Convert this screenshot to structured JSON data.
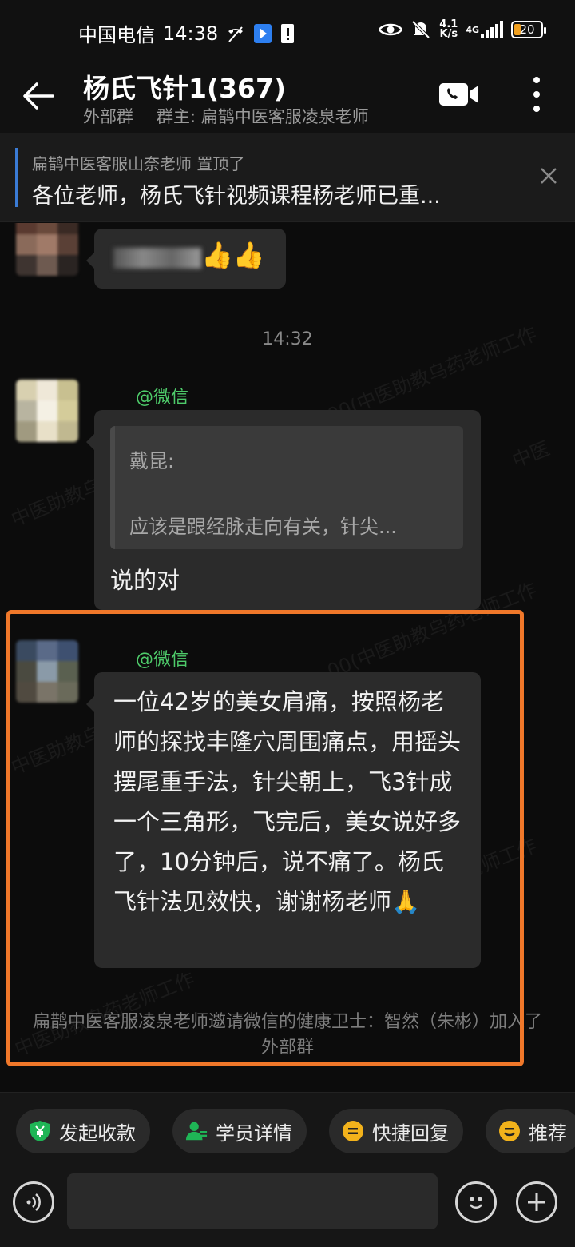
{
  "status_bar": {
    "carrier": "中国电信",
    "time": "14:38",
    "net_speed": "4.1",
    "net_unit": "K/s",
    "net_type": "4G",
    "battery": "20",
    "icons": [
      "no-call-icon",
      "app-notification-icon",
      "sim-alert-icon",
      "eye-icon",
      "mute-bell-icon",
      "signal-icon",
      "battery-icon"
    ]
  },
  "header": {
    "title": "杨氏飞针1(367)",
    "group_type": "外部群",
    "owner": "群主: 扁鹊中医客服凌泉老师"
  },
  "pinned": {
    "who": "扁鹊中医客服山奈老师 置顶了",
    "text": "各位老师，杨氏飞针视频课程杨老师已重..."
  },
  "messages": {
    "msg1_emoji": "👍👍",
    "time_divider": "14:32",
    "msg2": {
      "sender": "@微信",
      "quote_name": "戴昆:",
      "quote_text": "应该是跟经脉走向有关，针尖...",
      "text": "说的对"
    },
    "msg3": {
      "sender": "@微信",
      "text": "一位42岁的美女肩痛，按照杨老师的探找丰隆穴周围痛点，用摇头摆尾重手法，针尖朝上，飞3针成一个三角形，飞完后，美女说好多了，10分钟后，说不痛了。杨氏飞针法见效快，谢谢杨老师🙏"
    },
    "system": "扁鹊中医客服凌泉老师邀请微信的健康卫士：智然（朱彬）加入了外部群"
  },
  "quick_actions": [
    {
      "label": "发起收款",
      "icon": "payment-shield-icon",
      "color": "#1fb556"
    },
    {
      "label": "学员详情",
      "icon": "student-profile-icon",
      "color": "#1fb556"
    },
    {
      "label": "快捷回复",
      "icon": "quick-reply-icon",
      "color": "#f2b21b"
    },
    {
      "label": "推荐",
      "icon": "recommend-smile-icon",
      "color": "#f2b21b"
    }
  ],
  "input": {
    "placeholder": ""
  },
  "colors": {
    "accent_green": "#4ecb6a",
    "highlight": "#f0782a",
    "pin_bar": "#3a7bd5"
  }
}
